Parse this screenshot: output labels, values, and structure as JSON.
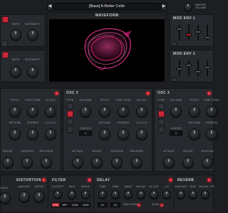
{
  "header": {
    "preset_name": "[Bass] A Better Cello",
    "prev_label": "◀",
    "next_label": "▶",
    "master_volume_label": "MASTER VOLUME"
  },
  "waveform": {
    "title": "WAVEFORM"
  },
  "left_top": {
    "rate": "RATE",
    "intensity": "INTENSITY"
  },
  "left_mid": {
    "rate": "RATE",
    "intensity": "INTENSITY"
  },
  "mod_env1": {
    "title": "MOD ENV 1"
  },
  "mod_env2": {
    "title": "MOD ENV 2"
  },
  "osc1": {
    "labels": {
      "pitch": "PITCH",
      "fine_tune": "FINE TUNE",
      "hi_cut": "HI-CUT",
      "detune": "DETUNE",
      "stereo": "STEREO",
      "lo_cut": "LO-CUT",
      "decay": "DECAY",
      "sustain": "SUSTAIN",
      "release": "RELEASE"
    }
  },
  "osc2": {
    "title": "OSC 2",
    "labels": {
      "type": "TYPE",
      "volume": "VOLUME",
      "pitch": "PITCH",
      "fine_tune": "FINE TUNE",
      "hi_cut": "HI-CUT",
      "voices": "VOICES",
      "voices_value": "1",
      "detune": "DETUNE",
      "stereo": "STEREO",
      "lo_cut": "LO-CUT",
      "attack": "ATTACK",
      "decay": "DECAY",
      "sustain": "SUSTAIN",
      "release": "RELEASE"
    }
  },
  "osc3": {
    "title": "OSC 3",
    "labels": {
      "type": "TYPE",
      "volume": "VOLUME",
      "pitch": "PITCH",
      "fine_tune": "FINE TUNE",
      "voices": "VOICES",
      "voices_value": "1",
      "detune": "DETUNE",
      "stereo": "STEREO",
      "attack": "ATTACK",
      "decay": "DECAY",
      "sustain": "SUSTAIN"
    }
  },
  "fx": {
    "distortion": {
      "title": "DISTORTION",
      "amount": "AMOUNT",
      "drive": "DRIVE",
      "left": "EATO"
    },
    "filter": {
      "title": "FILTER",
      "cutoff": "CUTOFF",
      "res": "RES",
      "drive": "DRIVE",
      "modes": [
        "LPG",
        "BPF",
        "12DB",
        "24DB"
      ]
    },
    "delay": {
      "title": "DELAY",
      "time": "TIME",
      "time_l": "TIME",
      "amnt": "AMNT",
      "decay": "DECAY",
      "hi_cut": "HI-CUT",
      "lo": "LO",
      "val1": "1/1",
      "val2": "1/1",
      "ping_pong": "PING-PONG",
      "sync": "SYNC"
    },
    "reverb": {
      "title": "REVERB",
      "amount": "AMOUNT",
      "size": "SIZE",
      "decay": "DECAY",
      "fr": "FR"
    }
  },
  "colors": {
    "accent": "#d8232f",
    "waveform_glow": "#ff2a8c"
  }
}
